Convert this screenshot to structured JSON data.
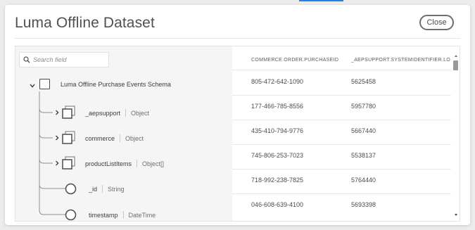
{
  "dialog": {
    "title": "Luma Offline Dataset",
    "close_label": "Close"
  },
  "search": {
    "placeholder": "Search field"
  },
  "schema_tree": {
    "root": {
      "name": "Luma Offline Purchase Events Schema"
    },
    "fields": [
      {
        "name": "_aepsupport",
        "type": "Object",
        "kind": "object"
      },
      {
        "name": "commerce",
        "type": "Object",
        "kind": "object"
      },
      {
        "name": "productListItems",
        "type": "Object[]",
        "kind": "object"
      },
      {
        "name": "_id",
        "type": "String",
        "kind": "primitive"
      },
      {
        "name": "timestamp",
        "type": "DateTime",
        "kind": "primitive"
      }
    ]
  },
  "table": {
    "columns": [
      "COMMERCE.ORDER.PURCHASEID",
      "_AEPSUPPORT.SYSTEMIDENTIFIER.LO"
    ],
    "rows": [
      [
        "805-472-642-1090",
        "5625458"
      ],
      [
        "177-466-785-8556",
        "5957780"
      ],
      [
        "435-410-794-9776",
        "5667440"
      ],
      [
        "745-806-253-7023",
        "5538137"
      ],
      [
        "718-992-238-7825",
        "5764440"
      ],
      [
        "046-608-639-4100",
        "5693398"
      ]
    ]
  },
  "colors": {
    "accent": "#2680eb",
    "panel_bg": "#f5f5f5",
    "tree_line": "#8e8e8e"
  }
}
